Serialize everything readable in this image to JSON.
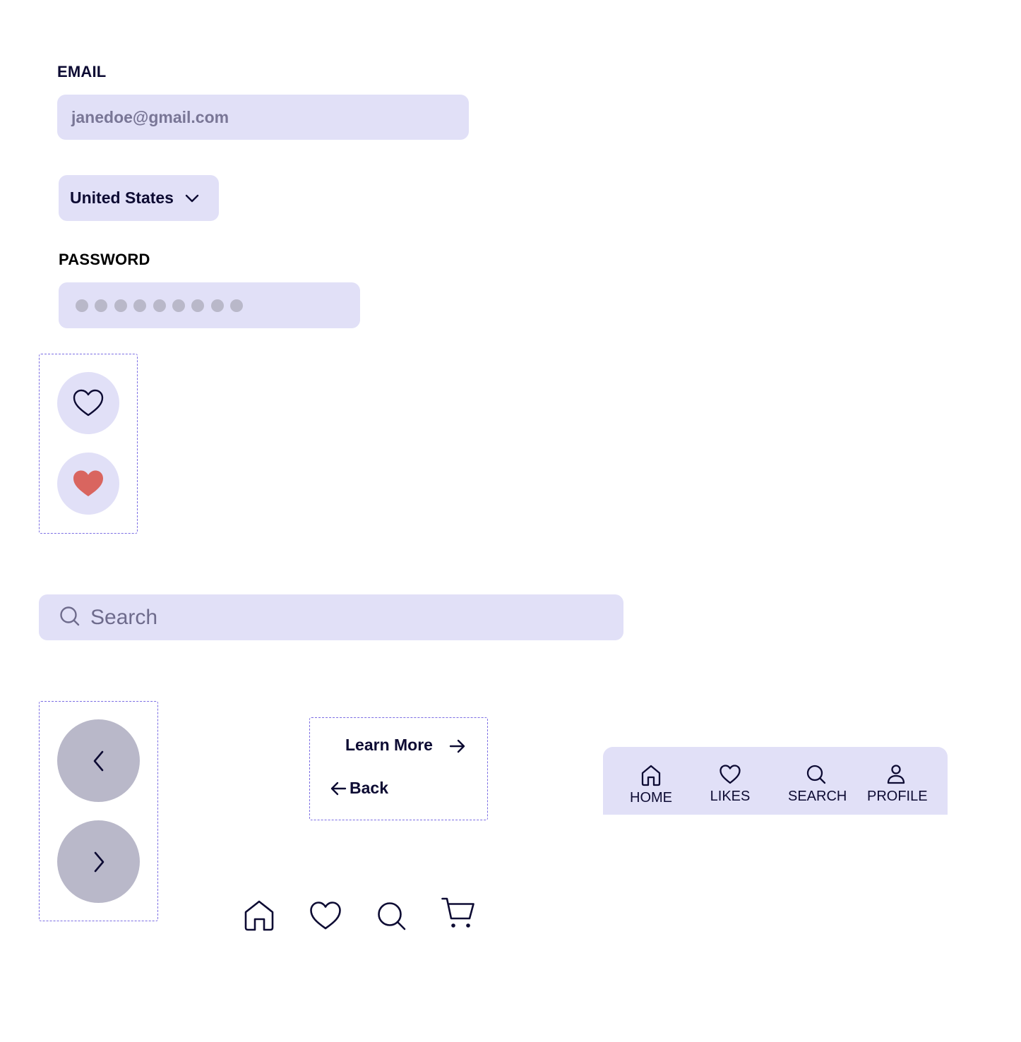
{
  "email": {
    "label": "EMAIL",
    "value": "janedoe@gmail.com"
  },
  "country": {
    "selected": "United States",
    "icon": "chevron-down-icon"
  },
  "password": {
    "label": "PASSWORD",
    "masked_length": 9
  },
  "like_buttons": {
    "outline_icon": "heart-outline-icon",
    "filled_icon": "heart-filled-icon",
    "filled_color": "#d9655f"
  },
  "search": {
    "placeholder": "Search",
    "icon": "search-icon"
  },
  "pager": {
    "prev_icon": "chevron-left-icon",
    "next_icon": "chevron-right-icon"
  },
  "links": {
    "learn_more": "Learn More",
    "back": "Back"
  },
  "bottom_nav": {
    "items": [
      {
        "label": "HOME",
        "icon": "home-icon"
      },
      {
        "label": "LIKES",
        "icon": "heart-icon"
      },
      {
        "label": "SEARCH",
        "icon": "search-icon"
      },
      {
        "label": "PROFILE",
        "icon": "user-icon"
      }
    ]
  },
  "icon_row": [
    "home-icon",
    "heart-icon",
    "search-icon",
    "cart-icon"
  ],
  "colors": {
    "field_bg": "#e1e0f7",
    "text_dark": "#0d0b33",
    "muted": "#6e6b8c",
    "circle_grey": "#b9b8c9",
    "dashed_border": "#7b6de3"
  }
}
